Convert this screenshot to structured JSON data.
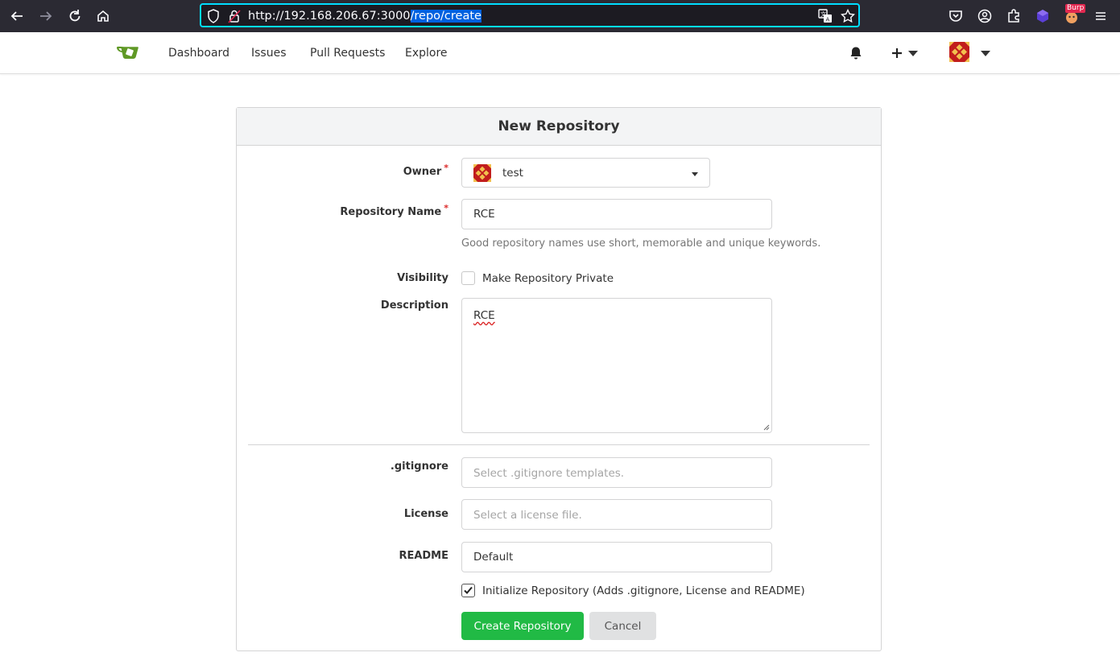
{
  "browser": {
    "url_host": "http://192.168.206.67:3000",
    "url_path": "/repo/create",
    "burp_label": "Burp"
  },
  "nav": {
    "links": [
      "Dashboard",
      "Issues",
      "Pull Requests",
      "Explore"
    ]
  },
  "form": {
    "title": "New Repository",
    "owner_label": "Owner",
    "owner_value": "test",
    "required_mark": "*",
    "repo_name_label": "Repository Name",
    "repo_name_value": "RCE",
    "repo_name_hint": "Good repository names use short, memorable and unique keywords.",
    "visibility_label": "Visibility",
    "private_label": "Make Repository Private",
    "private_checked": false,
    "description_label": "Description",
    "description_value": "RCE",
    "gitignore_label": ".gitignore",
    "gitignore_placeholder": "Select .gitignore templates.",
    "license_label": "License",
    "license_placeholder": "Select a license file.",
    "readme_label": "README",
    "readme_value": "Default",
    "init_label": "Initialize Repository (Adds .gitignore, License and README)",
    "init_checked": true,
    "create_button": "Create Repository",
    "cancel_button": "Cancel"
  },
  "colors": {
    "accent_green": "#21ba45",
    "logo_green": "#609926",
    "required_red": "#db2828",
    "url_focus": "#00ddff"
  }
}
